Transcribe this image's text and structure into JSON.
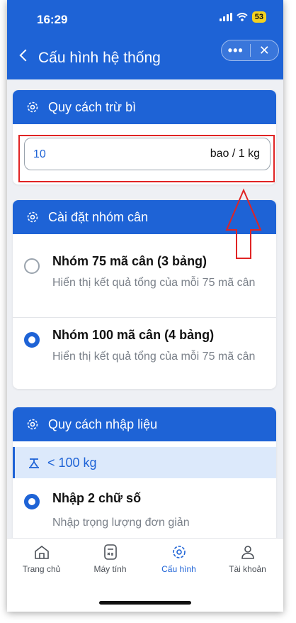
{
  "status": {
    "time": "16:29",
    "battery": "53"
  },
  "header": {
    "title": "Cấu hình hệ thống",
    "menu_label": "•••",
    "close_label": "✕"
  },
  "card_tare": {
    "title": "Quy cách trừ bì",
    "value": "10",
    "unit": "bao / 1 kg"
  },
  "card_group": {
    "title": "Cài đặt nhóm cân",
    "options": [
      {
        "title": "Nhóm 75 mã cân (3 bảng)",
        "desc": "Hiển thị kết quả tổng của mỗi 75 mã cân",
        "selected": false
      },
      {
        "title": "Nhóm 100 mã cân (4 bảng)",
        "desc": "Hiển thị kết quả tổng của mỗi 75 mã cân",
        "selected": true
      }
    ]
  },
  "card_input": {
    "title": "Quy cách nhập liệu",
    "range_label": "< 100 kg",
    "option": {
      "title": "Nhập 2 chữ số",
      "desc": "Nhập trọng lượng đơn giản",
      "selected": true
    }
  },
  "tabs": [
    {
      "label": "Trang chủ",
      "icon": "home-icon",
      "active": false
    },
    {
      "label": "Máy tính",
      "icon": "calculator-icon",
      "active": false
    },
    {
      "label": "Cấu hình",
      "icon": "gear-icon",
      "active": true
    },
    {
      "label": "Tài khoản",
      "icon": "user-icon",
      "active": false
    }
  ],
  "colors": {
    "primary": "#1e63d6",
    "annotation": "#e02424",
    "battery": "#f4d21f"
  }
}
